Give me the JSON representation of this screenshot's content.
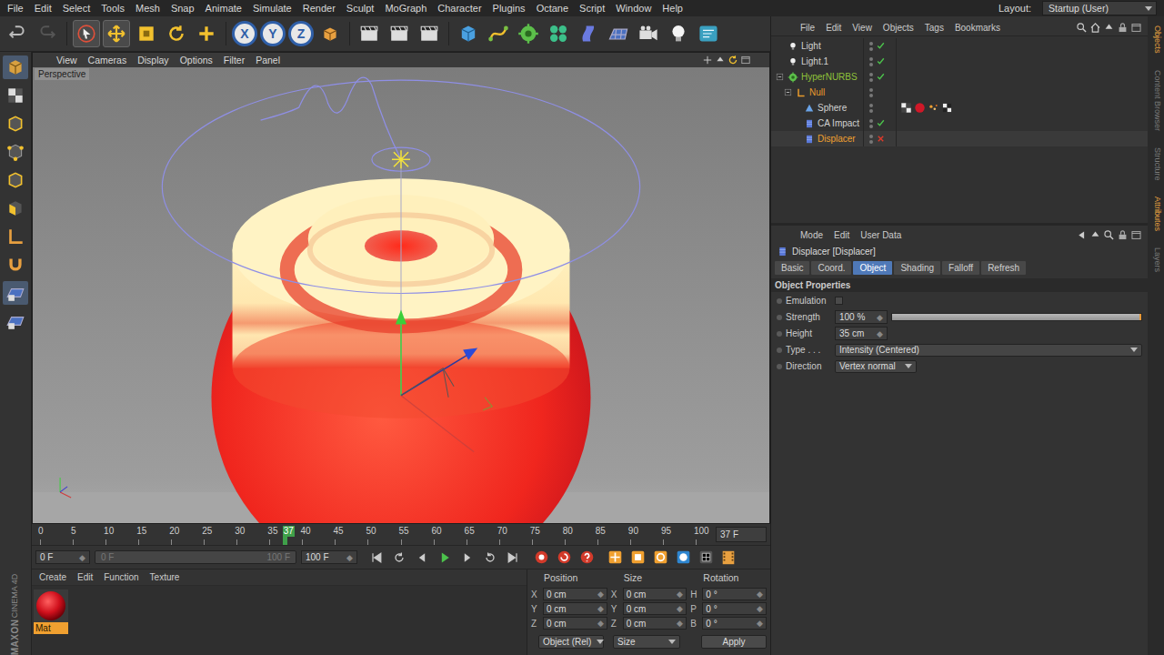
{
  "menubar": {
    "items": [
      "File",
      "Edit",
      "Select",
      "Tools",
      "Mesh",
      "Snap",
      "Animate",
      "Simulate",
      "Render",
      "Sculpt",
      "MoGraph",
      "Character",
      "Plugins",
      "Octane",
      "Script",
      "Window",
      "Help"
    ],
    "layout_label": "Layout:",
    "layout_value": "Startup (User)"
  },
  "toolbar": {
    "axis_buttons": [
      "X",
      "Y",
      "Z"
    ]
  },
  "viewport": {
    "menu": [
      "View",
      "Cameras",
      "Display",
      "Options",
      "Filter",
      "Panel"
    ],
    "camera": "Perspective"
  },
  "timeline": {
    "ticks": [
      "0",
      "5",
      "10",
      "15",
      "20",
      "25",
      "30",
      "35",
      "40",
      "45",
      "50",
      "55",
      "60",
      "65",
      "70",
      "75",
      "80",
      "85",
      "90",
      "95",
      "100"
    ],
    "current": "37",
    "level": 0.37,
    "frame": "37 F"
  },
  "playback": {
    "start": "0 F",
    "range_start": "0 F",
    "range_end": "100 F",
    "end": "100 F"
  },
  "materials": {
    "menu": [
      "Create",
      "Edit",
      "Function",
      "Texture"
    ],
    "items": [
      {
        "name": "Mat",
        "selected": true
      }
    ]
  },
  "coordinates": {
    "columns": [
      "Position",
      "Size",
      "Rotation"
    ],
    "rows": [
      {
        "axes": [
          "X",
          "X",
          "H"
        ],
        "values": [
          "0 cm",
          "0 cm",
          "0 °"
        ]
      },
      {
        "axes": [
          "Y",
          "Y",
          "P"
        ],
        "values": [
          "0 cm",
          "0 cm",
          "0 °"
        ]
      },
      {
        "axes": [
          "Z",
          "Z",
          "B"
        ],
        "values": [
          "0 cm",
          "0 cm",
          "0 °"
        ]
      }
    ],
    "mode": "Object (Rel)",
    "size_mode": "Size",
    "apply": "Apply"
  },
  "objects": {
    "menu": [
      "File",
      "Edit",
      "View",
      "Objects",
      "Tags",
      "Bookmarks"
    ],
    "rows": [
      {
        "name": "Light",
        "kind": "light",
        "depth": 0,
        "expandable": false,
        "expanded": false,
        "mark": "check",
        "color": "#d2d2d2",
        "selected": false,
        "tags": []
      },
      {
        "name": "Light.1",
        "kind": "light",
        "depth": 0,
        "expandable": false,
        "expanded": false,
        "mark": "check",
        "color": "#d2d2d2",
        "selected": false,
        "tags": []
      },
      {
        "name": "HyperNURBS",
        "kind": "nurbs",
        "depth": 0,
        "expandable": true,
        "expanded": true,
        "mark": "check",
        "color": "#8fc23a",
        "selected": false,
        "tags": []
      },
      {
        "name": "Null",
        "kind": "null",
        "depth": 1,
        "expandable": true,
        "expanded": true,
        "mark": "none",
        "color": "#e89a2c",
        "selected": false,
        "tags": []
      },
      {
        "name": "Sphere",
        "kind": "primitive",
        "depth": 2,
        "expandable": false,
        "expanded": false,
        "mark": "none",
        "color": "#d2d2d2",
        "selected": false,
        "tags": [
          "texture",
          "material",
          "dots",
          "checker"
        ]
      },
      {
        "name": "CA Impact",
        "kind": "deformer",
        "depth": 2,
        "expandable": false,
        "expanded": false,
        "mark": "check",
        "color": "#d2d2d2",
        "selected": false,
        "tags": []
      },
      {
        "name": "Displacer",
        "kind": "deformer",
        "depth": 2,
        "expandable": false,
        "expanded": false,
        "mark": "cross",
        "color": "#f0a030",
        "selected": true,
        "tags": []
      }
    ]
  },
  "attributes": {
    "menu": [
      "Mode",
      "Edit",
      "User Data"
    ],
    "title": "Displacer [Displacer]",
    "tabs": [
      {
        "label": "Basic",
        "selected": false
      },
      {
        "label": "Coord.",
        "selected": false
      },
      {
        "label": "Object",
        "selected": true
      },
      {
        "label": "Shading",
        "selected": false
      },
      {
        "label": "Falloff",
        "selected": false
      },
      {
        "label": "Refresh",
        "selected": false
      }
    ],
    "section": "Object Properties",
    "rows": [
      {
        "kind": "checkbox",
        "label": "Emulation",
        "checked": false,
        "value": "",
        "level": 0
      },
      {
        "kind": "slider",
        "label": "Strength",
        "checked": false,
        "value": "100 %",
        "level": 1
      },
      {
        "kind": "number",
        "label": "Height",
        "checked": false,
        "value": "35 cm",
        "level": 0
      },
      {
        "kind": "select-wide",
        "label": "Type . . .",
        "checked": false,
        "value": "Intensity (Centered)",
        "level": 0
      },
      {
        "kind": "select",
        "label": "Direction",
        "checked": false,
        "value": "Vertex normal",
        "level": 0
      }
    ]
  },
  "side_tabs": [
    {
      "label": "Objects",
      "selected": true
    },
    {
      "label": "Content Browser",
      "selected": false
    },
    {
      "label": "Structure",
      "selected": false
    },
    {
      "label": "Attributes",
      "selected": true
    },
    {
      "label": "Layers",
      "selected": false
    }
  ],
  "brand": {
    "company": "MAXON",
    "product": "CINEMA 4D"
  }
}
